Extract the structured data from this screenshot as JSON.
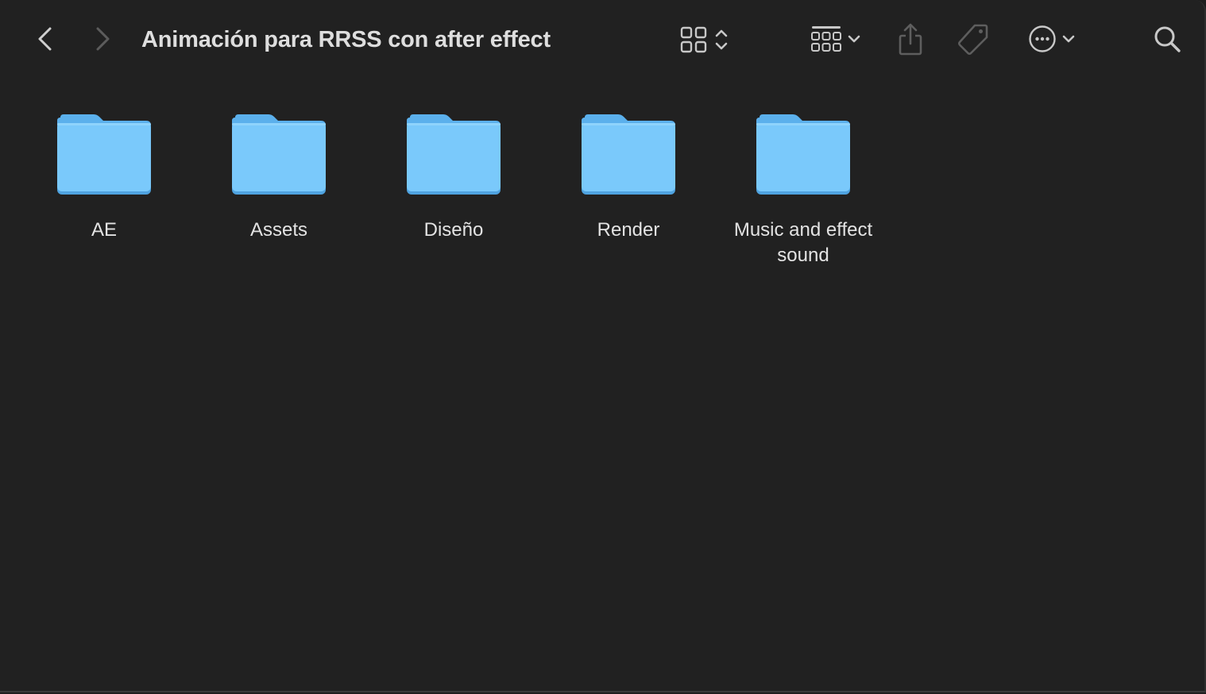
{
  "window": {
    "title": "Animación para RRSS con after effect"
  },
  "toolbar": {
    "back_icon": "chevron-left-icon",
    "forward_icon": "chevron-right-icon",
    "view_icon": "icon-grid-view-icon",
    "group_icon": "group-by-icon",
    "share_icon": "share-icon",
    "tag_icon": "tag-icon",
    "more_icon": "more-actions-icon",
    "search_icon": "search-icon"
  },
  "colors": {
    "background": "#212121",
    "folder_body": "#7ac9fb",
    "folder_tab": "#5bb0ec",
    "text": "#e3e3e3"
  },
  "folders": [
    {
      "name": "AE"
    },
    {
      "name": "Assets"
    },
    {
      "name": "Diseño"
    },
    {
      "name": "Render"
    },
    {
      "name": "Music and effect sound"
    }
  ]
}
